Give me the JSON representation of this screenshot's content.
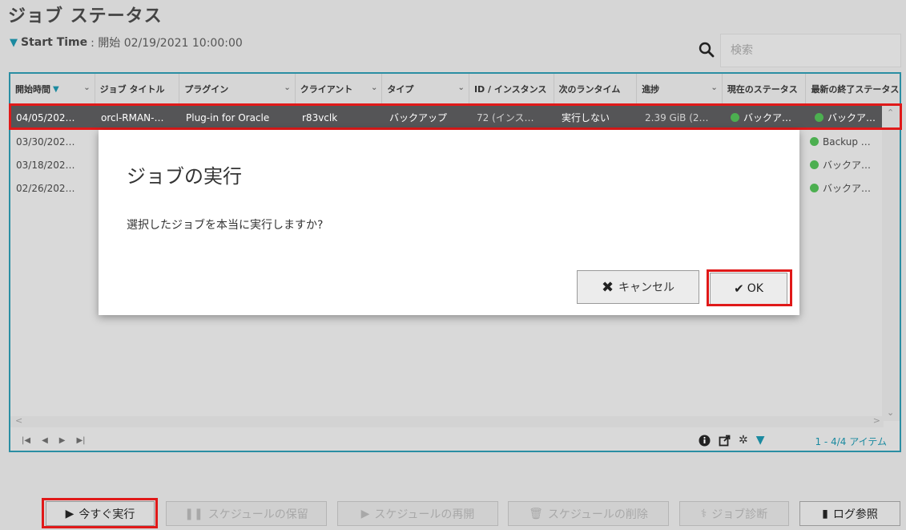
{
  "page": {
    "title": "ジョブ ステータス",
    "filter": {
      "label": "Start Time",
      "value": ": 開始 02/19/2021 10:00:00"
    },
    "search_placeholder": "検索"
  },
  "grid": {
    "columns": [
      {
        "label": "開始時間",
        "sorted": true
      },
      {
        "label": "ジョブ タイトル"
      },
      {
        "label": "プラグイン"
      },
      {
        "label": "クライアント"
      },
      {
        "label": "タイプ"
      },
      {
        "label": "ID / インスタンス"
      },
      {
        "label": "次のランタイム"
      },
      {
        "label": "進捗"
      },
      {
        "label": "現在のステータス"
      },
      {
        "label": "最新の終了ステータス"
      }
    ],
    "selected_row": {
      "start": "04/05/202…",
      "title": "orcl-RMAN-…",
      "plugin": "Plug-in for Oracle",
      "client": "r83vclk",
      "type": "バックアップ",
      "id": "72 (インス…",
      "next": "実行しない",
      "progress": "2.39 GiB (2…",
      "current_status": "バックア…",
      "last_status": "バックア…"
    },
    "rows": [
      {
        "start": "03/30/202…",
        "last_status": "Backup …"
      },
      {
        "start": "03/18/202…",
        "last_status": "バックア…"
      },
      {
        "start": "02/26/202…",
        "last_status": "バックア…"
      }
    ],
    "footer": {
      "item_count": "1 - 4/4 アイテム"
    }
  },
  "modal": {
    "title": "ジョブの実行",
    "message": "選択したジョブを本当に実行しますか?",
    "cancel_label": "キャンセル",
    "ok_label": "OK"
  },
  "toolbar": {
    "run_now": "今すぐ実行",
    "hold": "スケジュールの保留",
    "resume": "スケジュールの再開",
    "delete": "スケジュールの削除",
    "diagnose": "ジョブ診断",
    "log": "ログ参照"
  },
  "colors": {
    "accent": "#1b8aa0",
    "highlight": "#e01919",
    "status_ok": "#4caf50",
    "selected_row": "#555557"
  }
}
